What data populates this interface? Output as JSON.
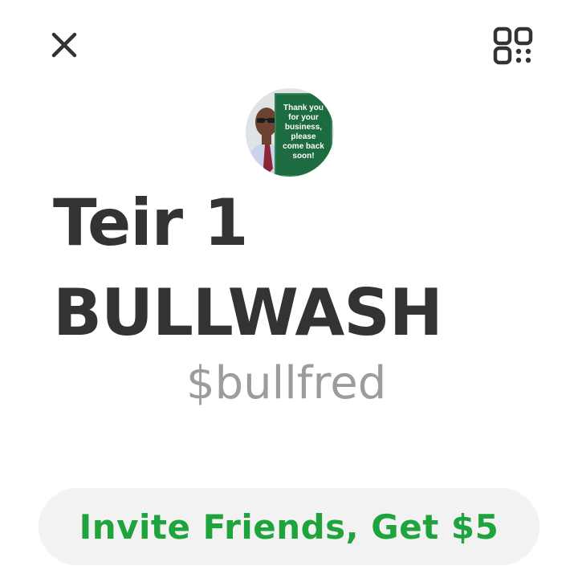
{
  "header": {
    "close_icon": "close-icon",
    "qr_icon": "qr-code-icon"
  },
  "profile": {
    "avatar_sign_text": [
      "Thank you",
      "for your",
      "business,",
      "please",
      "come back",
      "soon!"
    ],
    "name_line1": "Teir 1",
    "name_line2": "BULLWASH",
    "cashtag": "$bullfred"
  },
  "actions": {
    "invite_label": "Invite Friends, Get $5"
  },
  "colors": {
    "accent_green": "#1fa33d",
    "text_dark": "#333333",
    "text_muted": "#9c9c9c",
    "button_bg": "#f2f2f2"
  }
}
